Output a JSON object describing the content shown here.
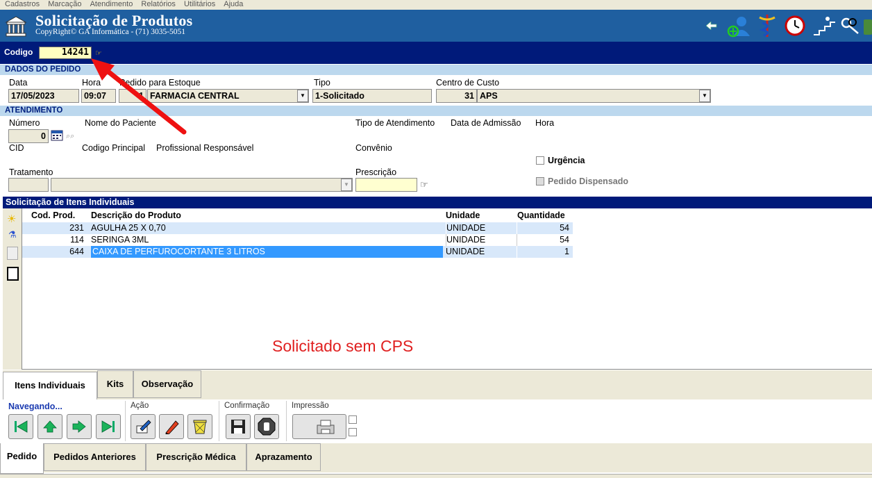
{
  "menu": [
    "Cadastros",
    "Marcação",
    "Atendimento",
    "Relatórios",
    "Utilitários",
    "Ajuda"
  ],
  "header": {
    "title": "Solicitação de Produtos",
    "subtitle": "CopyRight© GA Informática - (71) 3035-5051"
  },
  "codigo": {
    "label": "Codigo",
    "value": "14241"
  },
  "dados_pedido": {
    "section": "DADOS DO PEDIDO",
    "data_label": "Data",
    "data_value": "17/05/2023",
    "hora_label": "Hora",
    "hora_value": "09:07",
    "estoque_label": "Pedido para Estoque",
    "estoque_code": "1",
    "estoque_value": "FARMACIA CENTRAL",
    "tipo_label": "Tipo",
    "tipo_value": "1-Solicitado",
    "centro_label": "Centro de Custo",
    "centro_code": "31",
    "centro_value": "APS"
  },
  "atendimento": {
    "section": "ATENDIMENTO",
    "numero_label": "Número",
    "numero_value": "0",
    "paciente_label": "Nome do Paciente",
    "tipo_atend_label": "Tipo de Atendimento",
    "admissao_label": "Data de Admissão",
    "hora_label": "Hora",
    "cid_label": "CID",
    "codigo_principal_label": "Codigo Principal",
    "profissional_label": "Profissional Responsável",
    "convenio_label": "Convênio",
    "urgencia_label": "Urgência",
    "tratamento_label": "Tratamento",
    "prescricao_label": "Prescrição",
    "dispensado_label": "Pedido Dispensado"
  },
  "grid": {
    "title": "Solicitação de Itens Individuais",
    "columns": [
      "Cod. Prod.",
      "Descrição do Produto",
      "Unidade",
      "Quantidade"
    ],
    "rows": [
      {
        "cod": "231",
        "desc": "AGULHA 25 X 0,70",
        "unidade": "UNIDADE",
        "qtd": "54"
      },
      {
        "cod": "114",
        "desc": "SERINGA 3ML",
        "unidade": "UNIDADE",
        "qtd": "54"
      },
      {
        "cod": "644",
        "desc": "CAIXA DE PERFUROCORTANTE 3 LITROS",
        "unidade": "UNIDADE",
        "qtd": "1"
      }
    ],
    "annotation": "Solicitado sem CPS"
  },
  "tabs_inner": [
    "Itens Individuais",
    "Kits",
    "Observação"
  ],
  "toolbar": {
    "navegando": "Navegando...",
    "acao": "Ação",
    "confirmacao": "Confirmação",
    "impressao": "Impressão"
  },
  "tabs_bottom": [
    "Pedido",
    "Pedidos Anteriores",
    "Prescrição Médica",
    "Aprazamento"
  ],
  "colors": {
    "header": "#1f5fa0",
    "navband": "#001a7a",
    "section": "#bcd8ee",
    "selected_row": "#3399ff",
    "annotation": "#e02020",
    "arrow": "#ee1111"
  }
}
